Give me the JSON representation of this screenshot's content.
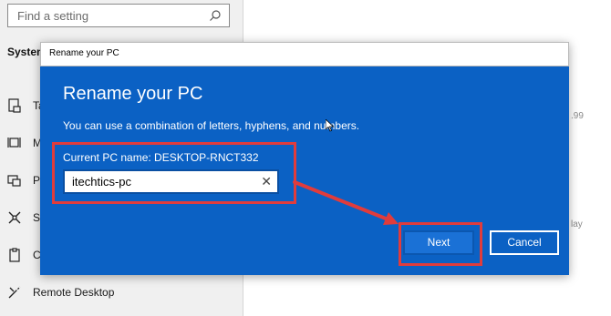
{
  "settings": {
    "search_placeholder": "Find a setting",
    "section_label": "System",
    "sidebar_items": [
      {
        "label": "Ta",
        "icon": "tablet-icon"
      },
      {
        "label": "M",
        "icon": "multitasking-icon"
      },
      {
        "label": "Pr",
        "icon": "projecting-icon"
      },
      {
        "label": "Sh",
        "icon": "shared-experiences-icon"
      },
      {
        "label": "Cl",
        "icon": "clipboard-icon"
      },
      {
        "label": "Remote Desktop",
        "icon": "remote-desktop-icon"
      }
    ],
    "right_fragments": [
      ".99",
      "lay"
    ]
  },
  "dialog": {
    "window_title": "Rename your PC",
    "heading": "Rename your PC",
    "description": "You can use a combination of letters, hyphens, and numbers.",
    "current_name": "Current PC name: DESKTOP-RNCT332",
    "input_value": "itechtics-pc",
    "clear_glyph": "✕",
    "next_label": "Next",
    "cancel_label": "Cancel",
    "accent_color": "#0b61c4",
    "highlight_color": "#e03c3c"
  }
}
